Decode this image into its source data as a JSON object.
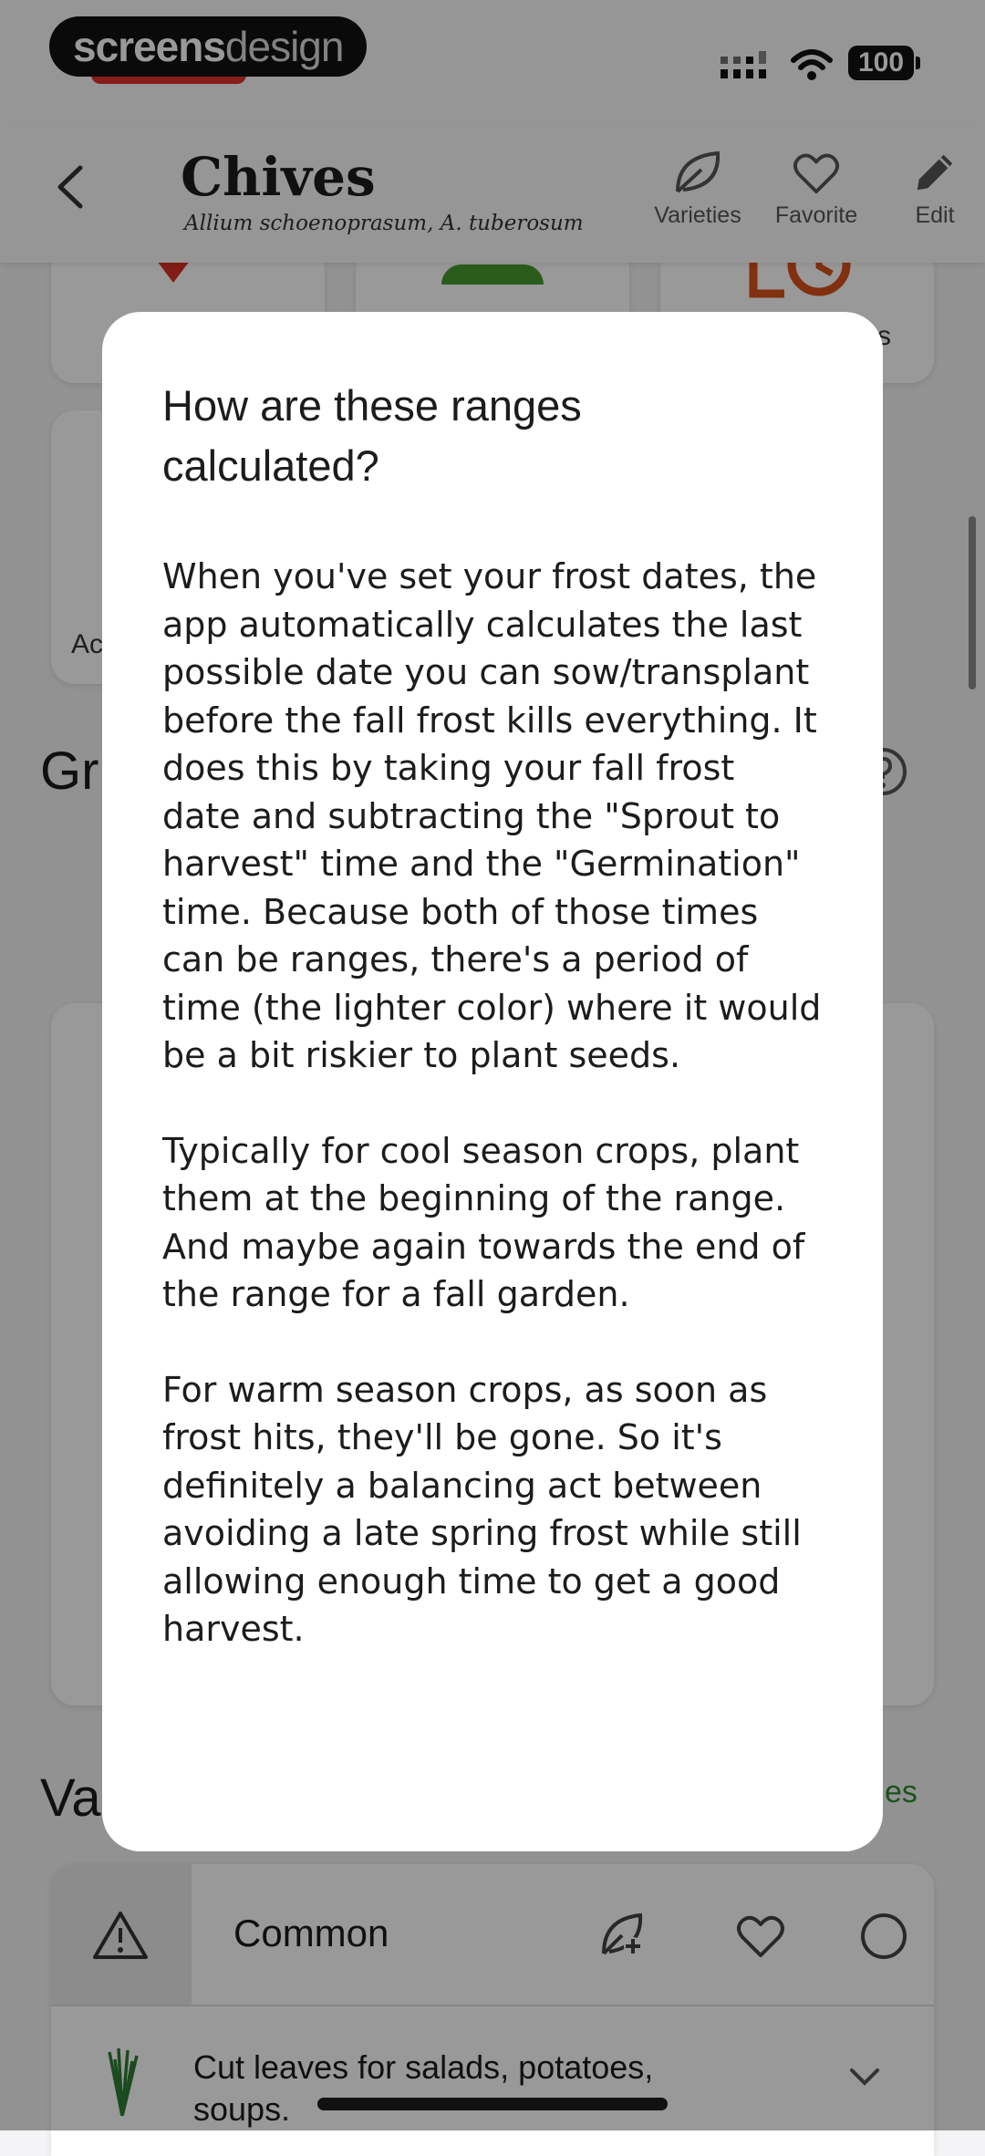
{
  "status_bar": {
    "watermark_bold": "screens",
    "watermark_light": "design",
    "battery": "100"
  },
  "header": {
    "title": "Chives",
    "subtitle": "Allium schoenoprasum, A. tuberosum",
    "actions": [
      {
        "label": "Varieties",
        "icon": "leaf-icon"
      },
      {
        "label": "Favorite",
        "icon": "heart-icon"
      },
      {
        "label": "Edit",
        "icon": "pencil-icon"
      }
    ]
  },
  "background": {
    "card_3_text": "s",
    "card_4_text": "Ac",
    "section_g": "Gr",
    "section_v": "Va",
    "varieties_link": "es"
  },
  "variety": {
    "name": "Common",
    "description": "Cut leaves for salads, potatoes, soups."
  },
  "dialog": {
    "title": "How are these ranges calculated?",
    "paragraphs": [
      "When you've set your frost dates, the app automatically calculates the last possible date you can sow/transplant before the fall frost kills everything. It does this by taking your fall frost date and subtracting the \"Sprout to harvest\" time and the \"Germination\" time. Because both of those times can be ranges, there's a period of time (the lighter color) where it would be a bit riskier to plant seeds.",
      "Typically for cool season crops, plant them at the beginning of the range. And maybe again towards the end of the range for a fall garden.",
      "For warm season crops, as soon as frost hits, they'll be gone. So it's definitely a balancing act between avoiding a late spring frost while still allowing enough time to get a good harvest."
    ]
  },
  "colors": {
    "accent_green": "#2e8b2e",
    "icon_red": "#d93025",
    "icon_orange": "#d8501c"
  }
}
